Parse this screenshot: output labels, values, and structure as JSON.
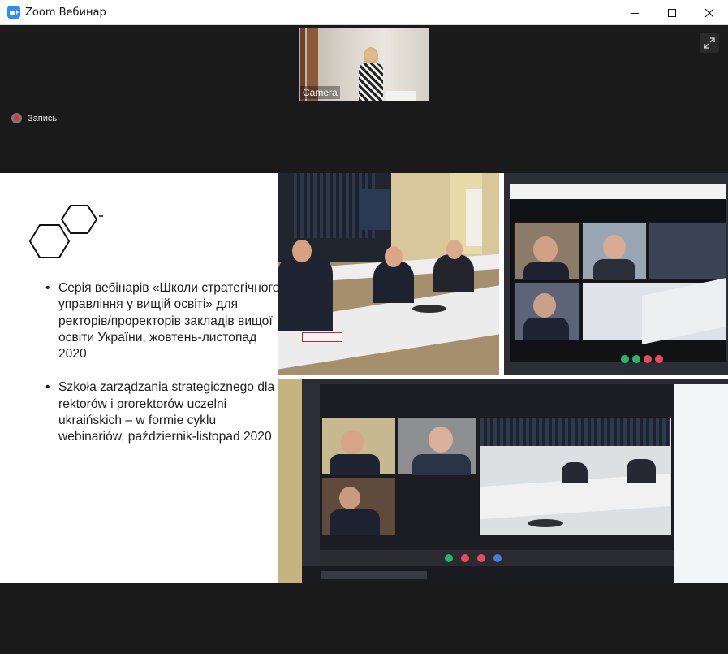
{
  "window": {
    "title": "Zoom Вебинар",
    "controls": [
      "minimize-icon",
      "maximize-icon",
      "close-icon"
    ]
  },
  "meeting": {
    "camera_tile": {
      "label": "Camera"
    },
    "recording": {
      "label": "Запись",
      "color": "#e8312d"
    },
    "fullscreen": {
      "icon": "expand-icon"
    }
  },
  "slide": {
    "logo": "hexagon-logo",
    "bullets": [
      {
        "text": "Серія вебінарів «Школи стратегічного управління у вищій освіті» для ректорів/проректорів закладів вищої освіти України, жовтень-листопад 2020"
      },
      {
        "text": "Szkoła zarządzania strategicznego dla rektorów i prorektorów uczelni ukraińskich – w formie cyklu webinariów, październik-listopad 2020"
      }
    ],
    "bullet_symbol": "•"
  },
  "colors": {
    "zoom_blue": "#2d8cff",
    "meeting_bg": "#1a1a1a",
    "slide_bg": "#ffffff"
  }
}
